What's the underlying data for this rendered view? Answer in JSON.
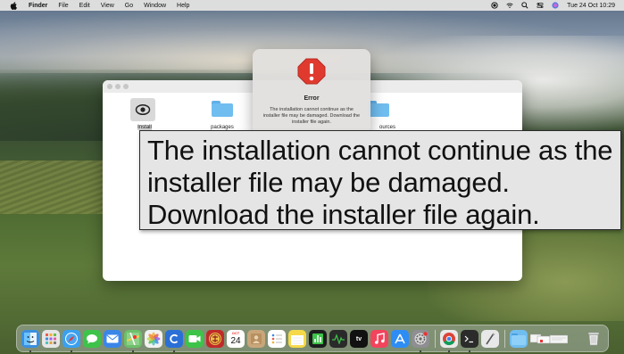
{
  "menubar": {
    "app_name": "Finder",
    "menus": [
      "File",
      "Edit",
      "View",
      "Go",
      "Window",
      "Help"
    ],
    "clock": "Tue 24 Oct  10:29",
    "status_icons": [
      "record-icon",
      "wifi-icon",
      "search-icon",
      "control-center-icon",
      "siri-icon"
    ]
  },
  "finder": {
    "files": [
      {
        "label": "Install",
        "icon": "installer-app-icon"
      },
      {
        "label": "packages",
        "icon": "folder-icon"
      },
      {
        "label": "ources",
        "icon": "folder-icon"
      }
    ]
  },
  "dialog": {
    "title": "Error",
    "message": "The installation cannot continue as the installer file may be damaged. Download the installer file again.",
    "icon": "warning-icon"
  },
  "caption": {
    "text": "The installation cannot continue as the installer file may be damaged. Download the installer file again."
  },
  "dock": {
    "calendar_month": "OCT",
    "calendar_day": "24",
    "appletv_label": "tv",
    "colors": {
      "finder": "#3b8fe0",
      "launchpad": "#e6e6e6",
      "safari": "#3aa0f0",
      "messages": "#3ec34a",
      "mail": "#3a86e8",
      "maps": "#6cc06a",
      "photos": "#f1f1f1",
      "cisco": "#2a6fd6",
      "contacts": "#c9a67a",
      "reminders": "#ffffff",
      "notes": "#f5d94a",
      "tv": "#111111",
      "music": "#f2445c",
      "appstore": "#2e8cf5",
      "settings": "#8e8e93",
      "chrome": "#e9e9e9",
      "terminal": "#2b2b2b"
    }
  }
}
